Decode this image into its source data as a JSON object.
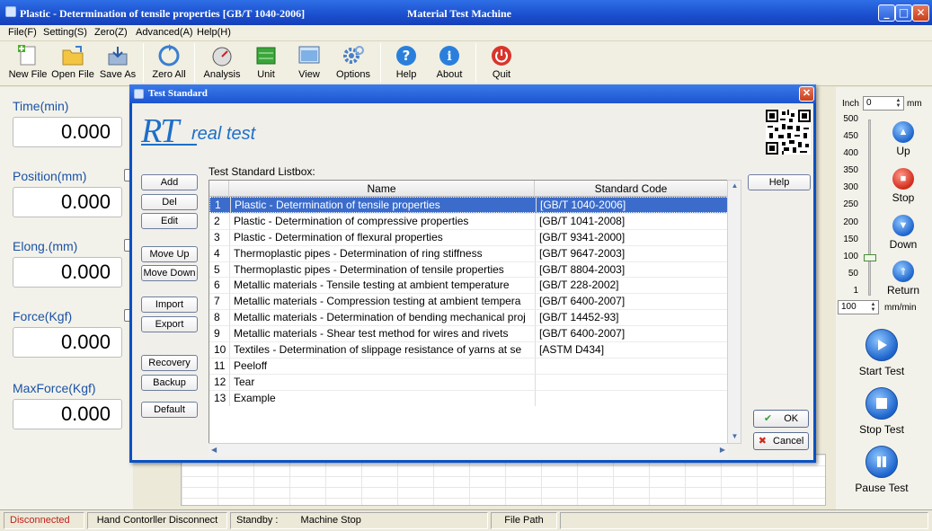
{
  "window": {
    "title": "Plastic - Determination of tensile properties [GB/T 1040-2006]",
    "app_name": "Material Test Machine",
    "min": "_",
    "max": "□",
    "close": "✕"
  },
  "menu": [
    "File(F)",
    "Setting(S)",
    "Zero(Z)",
    "Advanced(A)",
    "Help(H)"
  ],
  "toolbar": [
    {
      "label": "New File",
      "icon": "new-file-icon"
    },
    {
      "label": "Open File",
      "icon": "open-folder-icon"
    },
    {
      "label": "Save As",
      "icon": "save-as-icon"
    },
    {
      "label": "Zero All",
      "icon": "zero-all-icon"
    },
    {
      "label": "Analysis",
      "icon": "analysis-icon"
    },
    {
      "label": "Unit",
      "icon": "unit-icon"
    },
    {
      "label": "View",
      "icon": "view-icon"
    },
    {
      "label": "Options",
      "icon": "gear-icon"
    },
    {
      "label": "Help",
      "icon": "help-icon"
    },
    {
      "label": "About",
      "icon": "info-icon"
    },
    {
      "label": "Quit",
      "icon": "power-icon"
    }
  ],
  "readouts": [
    {
      "label": "Time(min)",
      "value": "0.000"
    },
    {
      "label": "Position(mm)",
      "value": "0.000"
    },
    {
      "label": "Elong.(mm)",
      "value": "0.000"
    },
    {
      "label": "Force(Kgf)",
      "value": "0.000"
    },
    {
      "label": "MaxForce(Kgf)",
      "value": "0.000"
    }
  ],
  "right_panel": {
    "inch_label": "Inch",
    "inch_value": "0",
    "mm_label": "mm",
    "scale": [
      "500",
      "450",
      "400",
      "350",
      "300",
      "250",
      "200",
      "150",
      "100",
      "50",
      "1"
    ],
    "speed_value": "100",
    "speed_unit": "mm/min",
    "up": "Up",
    "stop": "Stop",
    "down": "Down",
    "return": "Return",
    "start_test": "Start Test",
    "stop_test": "Stop Test",
    "pause_test": "Pause Test"
  },
  "statusbar": {
    "connection": "Disconnected",
    "hand_controller": "Hand Contorller Disconnect",
    "standby_label": "Standby :",
    "machine_state": "Machine Stop",
    "file_path_label": "File Path"
  },
  "dialog": {
    "title": "Test Standard",
    "close": "✕",
    "logo_main": "RT",
    "logo_sub": "real test",
    "list_label": "Test Standard Listbox:",
    "col_name": "Name",
    "col_code": "Standard Code",
    "buttons": {
      "add": "Add",
      "del": "Del",
      "edit": "Edit",
      "move_up": "Move Up",
      "move_down": "Move Down",
      "import": "Import",
      "export": "Export",
      "recovery": "Recovery",
      "backup": "Backup",
      "default": "Default",
      "help": "Help",
      "ok": "OK",
      "cancel": "Cancel"
    },
    "rows": [
      {
        "n": "1",
        "name": "Plastic - Determination of tensile properties",
        "code": "[GB/T 1040-2006]"
      },
      {
        "n": "2",
        "name": "Plastic - Determination of compressive properties",
        "code": "[GB/T 1041-2008]"
      },
      {
        "n": "3",
        "name": "Plastic - Determination of flexural properties",
        "code": "[GB/T 9341-2000]"
      },
      {
        "n": "4",
        "name": "Thermoplastic pipes - Determination of ring stiffness",
        "code": "[GB/T 9647-2003]"
      },
      {
        "n": "5",
        "name": "Thermoplastic pipes - Determination of tensile properties",
        "code": "[GB/T 8804-2003]"
      },
      {
        "n": "6",
        "name": "Metallic materials - Tensile testing at ambient temperature",
        "code": "[GB/T 228-2002]"
      },
      {
        "n": "7",
        "name": "Metallic materials - Compression testing at ambient tempera",
        "code": "[GB/T 6400-2007]"
      },
      {
        "n": "8",
        "name": "Metallic materials - Determination of bending mechanical proj",
        "code": "[GB/T 14452-93]"
      },
      {
        "n": "9",
        "name": "Metallic materials - Shear test method for wires and rivets",
        "code": "[GB/T 6400-2007]"
      },
      {
        "n": "10",
        "name": "Textiles - Determination of slippage resistance of yarns at se",
        "code": "[ASTM D434]"
      },
      {
        "n": "11",
        "name": "Peeloff",
        "code": ""
      },
      {
        "n": "12",
        "name": "Tear",
        "code": ""
      },
      {
        "n": "13",
        "name": "Example",
        "code": ""
      }
    ],
    "selected_row": 0
  }
}
